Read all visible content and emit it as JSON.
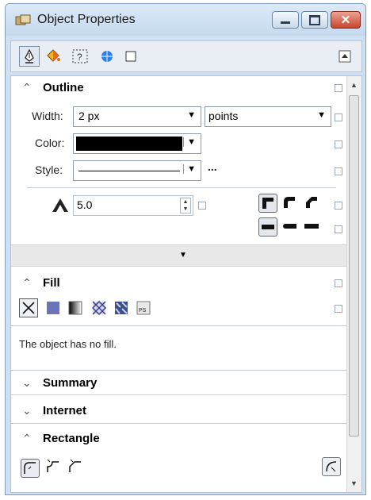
{
  "window": {
    "title": "Object Properties",
    "close_glyph": "✕"
  },
  "toolbar": {
    "tools": [
      "outline-pen-icon",
      "fill-bucket-icon",
      "transparency-icon",
      "internet-icon",
      "rectangle-icon"
    ]
  },
  "outline": {
    "title": "Outline",
    "width_label": "Width:",
    "width_value": "2 px",
    "units_value": "points",
    "color_label": "Color:",
    "color_value": "#000000",
    "style_label": "Style:",
    "style_more": "...",
    "miter_value": "5.0"
  },
  "fill": {
    "title": "Fill",
    "message": "The object has no fill."
  },
  "sections": {
    "summary": "Summary",
    "internet": "Internet",
    "rectangle": "Rectangle"
  }
}
